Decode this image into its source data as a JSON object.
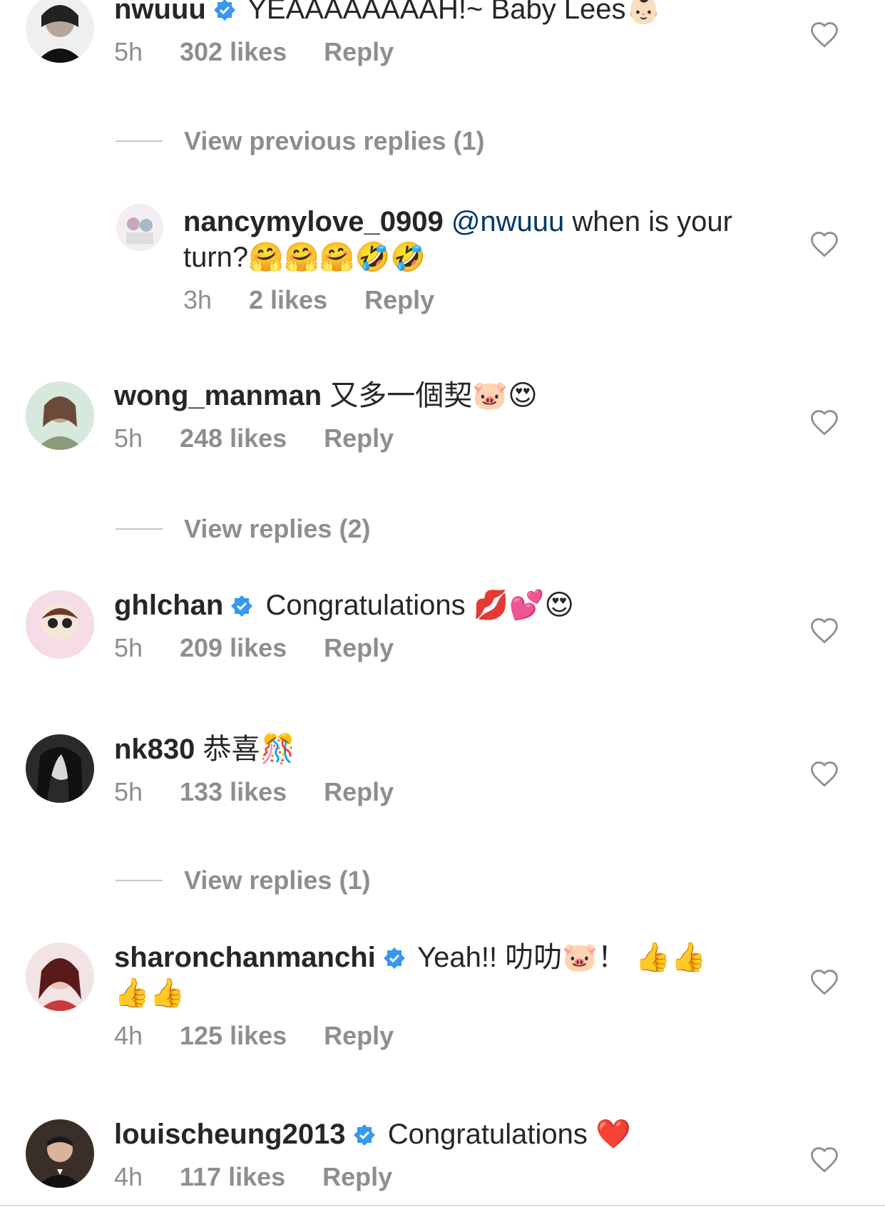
{
  "comments": [
    {
      "username": "nwuuu",
      "verified": true,
      "text": "YEAAAAAAAAH!~ Baby Lees",
      "emoji": "👶🏻",
      "time": "5h",
      "likes": "302 likes",
      "reply_label": "Reply"
    },
    {
      "username": "nancymylove_0909",
      "verified": false,
      "mention": "@nwuuu",
      "text": "when is your turn?",
      "emoji": "🤗🤗🤗🤣🤣",
      "time": "3h",
      "likes": "2 likes",
      "reply_label": "Reply"
    },
    {
      "username": "wong_manman",
      "verified": false,
      "text": "又多一個契",
      "emoji": "🐷😍",
      "time": "5h",
      "likes": "248 likes",
      "reply_label": "Reply"
    },
    {
      "username": "ghlchan",
      "verified": true,
      "text": "Congratulations",
      "emoji": "💋💕😍",
      "time": "5h",
      "likes": "209 likes",
      "reply_label": "Reply"
    },
    {
      "username": "nk830",
      "verified": false,
      "text": "恭喜",
      "emoji": "🎊",
      "time": "5h",
      "likes": "133 likes",
      "reply_label": "Reply"
    },
    {
      "username": "sharonchanmanchi",
      "verified": true,
      "text": "Yeah!! 叻叻",
      "emoji": "🐷！ 👍👍👍👍",
      "time": "4h",
      "likes": "125 likes",
      "reply_label": "Reply"
    },
    {
      "username": "louischeung2013",
      "verified": true,
      "text": "Congratulations",
      "emoji": "❤️",
      "time": "4h",
      "likes": "117 likes",
      "reply_label": "Reply"
    }
  ],
  "view_replies": [
    {
      "label": "View previous replies (1)"
    },
    {
      "label": "View replies (2)"
    },
    {
      "label": "View replies (1)"
    }
  ],
  "icons": {
    "heart": "heart-outline-icon",
    "verified": "verified-badge-icon"
  },
  "colors": {
    "verified_blue": "#3897f0",
    "mention": "#00376b",
    "secondary_text": "#8e8e8e"
  }
}
